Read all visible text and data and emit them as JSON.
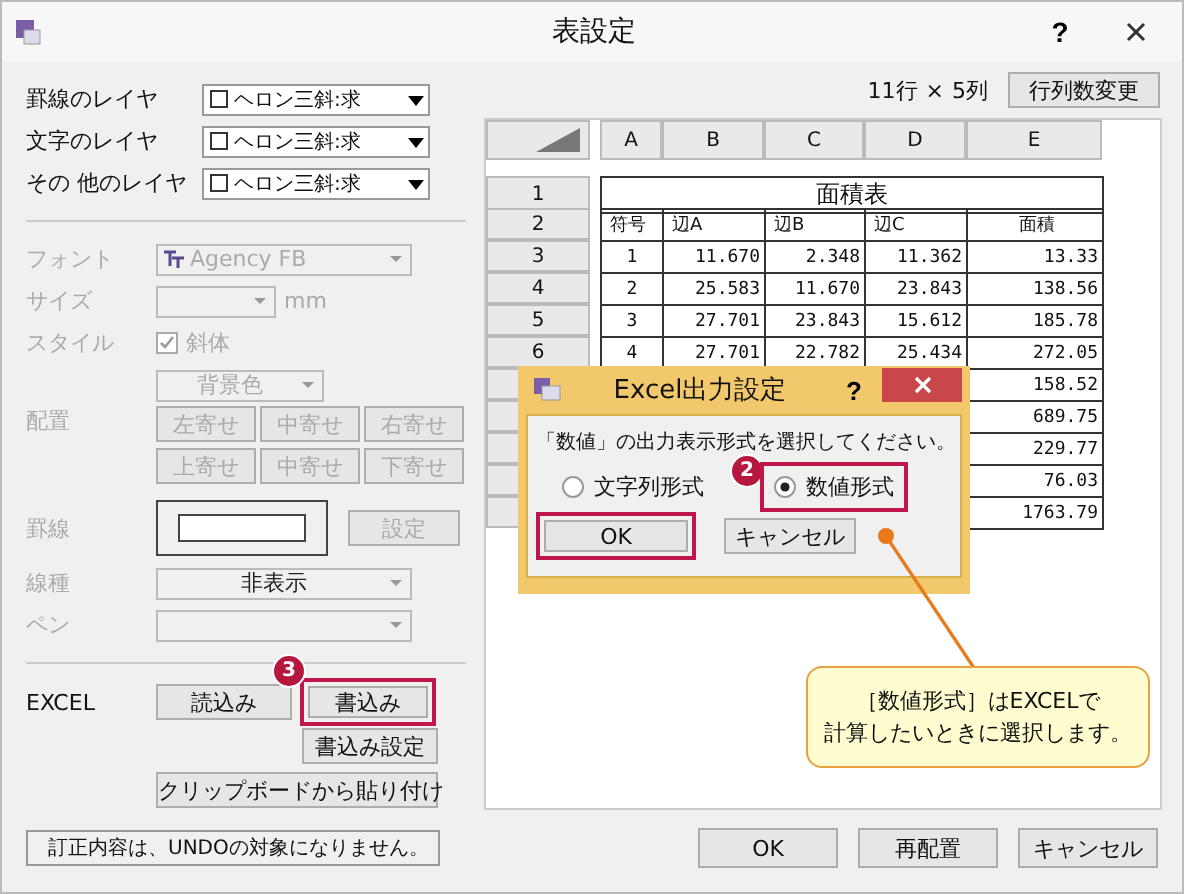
{
  "window": {
    "title": "表設定",
    "help_button": "?"
  },
  "layers": [
    {
      "label": "罫線のレイヤ",
      "value": "ヘロン三斜:求"
    },
    {
      "label": "文字のレイヤ",
      "value": "ヘロン三斜:求"
    },
    {
      "label": "その 他のレイヤ",
      "value": "ヘロン三斜:求"
    }
  ],
  "format": {
    "disabled": true,
    "font": {
      "label": "フォント",
      "value": "Agency FB"
    },
    "size": {
      "label": "サイズ",
      "unit": "mm"
    },
    "style": {
      "label": "スタイル",
      "italic": {
        "label": "斜体",
        "checked": true
      }
    },
    "background": "背景色",
    "align": {
      "label": "配置",
      "buttons": [
        "左寄せ",
        "中寄せ",
        "右寄せ",
        "上寄せ",
        "中寄せ",
        "下寄せ"
      ]
    },
    "border": {
      "label": "罫線",
      "button": "設定"
    },
    "line_type": {
      "label": "線種",
      "value": "非表示"
    },
    "pen": {
      "label": "ペン"
    }
  },
  "excel": {
    "label": "EXCEL",
    "buttons": [
      {
        "label": "読込み",
        "highlighted": false
      },
      {
        "label": "書込み",
        "highlighted": true,
        "step": "3"
      },
      {
        "label": "書込み設定",
        "highlighted": false
      },
      {
        "label": "クリップボードから貼り付け",
        "highlighted": false
      }
    ]
  },
  "grid": {
    "size_rows": "11行",
    "size_times": "×",
    "size_cols": "5列",
    "resize_button": "行列数変更",
    "columns": [
      "A",
      "B",
      "C",
      "D",
      "E"
    ],
    "rows": [
      {
        "kind": "title",
        "header": "1",
        "text": "面積表"
      },
      {
        "kind": "head",
        "header": "2",
        "cells": [
          "符号",
          "辺A",
          "辺B",
          "辺C",
          "面積"
        ]
      },
      {
        "kind": "data",
        "header": "3",
        "cells": [
          "1",
          "11.670",
          "2.348",
          "11.362",
          "13.33"
        ]
      },
      {
        "kind": "data",
        "header": "4",
        "cells": [
          "2",
          "25.583",
          "11.670",
          "23.843",
          "138.56"
        ]
      },
      {
        "kind": "data",
        "header": "5",
        "cells": [
          "3",
          "27.701",
          "23.843",
          "15.612",
          "185.78"
        ]
      },
      {
        "kind": "data",
        "header": "6",
        "cells": [
          "4",
          "27.701",
          "22.782",
          "25.434",
          "272.05"
        ]
      },
      {
        "kind": "data",
        "header": null,
        "cells": [
          null,
          null,
          null,
          null,
          "158.52"
        ]
      },
      {
        "kind": "data",
        "header": null,
        "cells": [
          null,
          null,
          null,
          null,
          "689.75"
        ]
      },
      {
        "kind": "data",
        "header": null,
        "cells": [
          null,
          null,
          null,
          null,
          "229.77"
        ]
      },
      {
        "kind": "data",
        "header": null,
        "cells": [
          null,
          null,
          null,
          null,
          "76.03"
        ]
      },
      {
        "kind": "data",
        "header": null,
        "cells": [
          null,
          null,
          null,
          null,
          "1763.79"
        ]
      }
    ]
  },
  "status_bar": "訂正内容は、UNDOの対象になりません。",
  "buttons": [
    "OK",
    "再配置",
    "キャンセル"
  ],
  "dialog": {
    "title": "Excel出力設定",
    "help_button": "?",
    "message": "「数値」の出力表示形式を選択してください。",
    "options": [
      {
        "label": "文字列形式",
        "selected": false,
        "highlighted": false
      },
      {
        "label": "数値形式",
        "selected": true,
        "highlighted": true,
        "step": "2"
      }
    ],
    "buttons": [
      {
        "label": "OK",
        "highlighted": true
      },
      {
        "label": "キャンセル",
        "highlighted": false
      }
    ]
  },
  "callout": [
    "［数値形式］はEXCELで",
    "計算したいときに選択します。"
  ]
}
